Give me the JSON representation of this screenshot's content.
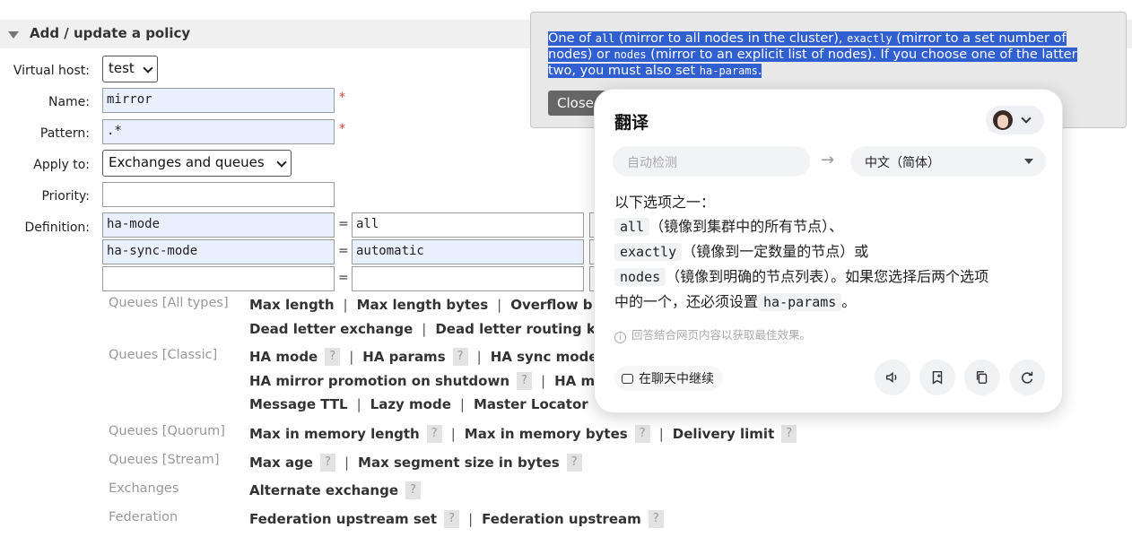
{
  "section": {
    "title": "Add / update a policy"
  },
  "form": {
    "vhost_label": "Virtual host:",
    "vhost_value": "test",
    "name_label": "Name:",
    "name_value": "mirror",
    "pattern_label": "Pattern:",
    "pattern_value": ".*",
    "apply_label": "Apply to:",
    "apply_value": "Exchanges and queues",
    "priority_label": "Priority:",
    "priority_value": "",
    "definition_label": "Definition:",
    "required_mark": "*",
    "equals": "=",
    "definitions": [
      {
        "key": "ha-mode",
        "value": "all"
      },
      {
        "key": "ha-sync-mode",
        "value": "automatic"
      },
      {
        "key": "",
        "value": ""
      }
    ]
  },
  "categories": {
    "queues_all": "Queues [All types]",
    "queues_classic": "Queues [Classic]",
    "queues_quorum": "Queues [Quorum]",
    "queues_stream": "Queues [Stream]",
    "exchanges": "Exchanges",
    "federation": "Federation"
  },
  "options": {
    "all_1": [
      "Max length",
      "Max length bytes",
      "Overflow b"
    ],
    "all_2": [
      "Dead letter exchange",
      "Dead letter routing k"
    ],
    "classic_1": [
      "HA mode",
      "HA params",
      "HA sync mode"
    ],
    "classic_2": [
      "HA mirror promotion on shutdown",
      "HA m"
    ],
    "classic_3": [
      "Message TTL",
      "Lazy mode",
      "Master Locator"
    ],
    "quorum": [
      "Max in memory length",
      "Max in memory bytes",
      "Delivery limit"
    ],
    "stream": [
      "Max age",
      "Max segment size in bytes"
    ],
    "exchanges": [
      "Alternate exchange"
    ],
    "federation": [
      "Federation upstream set",
      "Federation upstream"
    ],
    "help_mark": "?",
    "separator": "|"
  },
  "help": {
    "line1_a": "One of ",
    "line1_code1": "all",
    "line1_b": " (mirror to all nodes in the cluster), ",
    "line1_code2": "exactly",
    "line1_c": " (mirror to a set number of",
    "line2_code": "nodes",
    "line2_pre": "nodes) or ",
    "line2_b": " (mirror to an explicit list of nodes). If you choose one of the latter",
    "line3_a": "two, you must also set ",
    "line3_code": "ha-params",
    "line3_b": ".",
    "close": "Close"
  },
  "translate": {
    "title": "翻译",
    "source_lang": "自动检测",
    "target_lang": "中文（简体）",
    "line1": "以下选项之一：",
    "code_all": "all",
    "text_all": "（镜像到集群中的所有节点）、",
    "code_exactly": "exactly",
    "text_exactly": "（镜像到一定数量的节点）或",
    "code_nodes": "nodes",
    "text_nodes": "（镜像到明确的节点列表）。如果您选择后两个选项",
    "line_last_a": "中的一个，还必须设置",
    "code_params": "ha-params",
    "line_last_b": "。",
    "note": "回答结合网页内容以获取最佳效果。",
    "chat": "在聊天中继续",
    "icons": [
      "speaker-icon",
      "bookmark-icon",
      "copy-icon",
      "refresh-icon"
    ]
  },
  "colors": {
    "selection": "#2f5fd1",
    "required": "#e04040",
    "input_highlight": "#e8effd"
  }
}
